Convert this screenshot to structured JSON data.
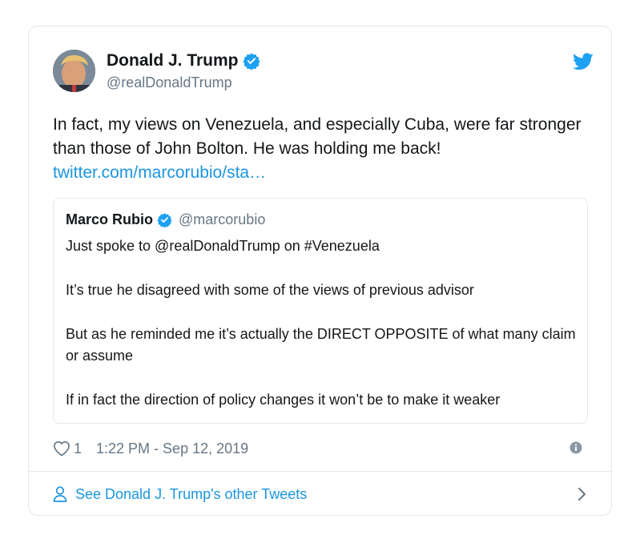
{
  "tweet": {
    "author_name": "Donald J. Trump",
    "author_handle": "@realDonaldTrump",
    "text": "In fact, my views on Venezuela, and especially Cuba, were far stronger than those of John Bolton. He was holding me back!",
    "link": "twitter.com/marcorubio/sta…",
    "likes": "1",
    "timestamp": "1:22 PM - Sep 12, 2019"
  },
  "quote": {
    "author_name": "Marco Rubio",
    "author_handle": "@marcorubio",
    "paragraphs": [
      "Just spoke to @realDonaldTrump on #Venezuela",
      "It’s true he disagreed with some of the views of previous advisor",
      "But as he reminded me it’s actually the DIRECT OPPOSITE of what many claim or assume",
      "If in fact the direction of policy changes it won’t be to make it weaker"
    ]
  },
  "footer": {
    "see_more": "See Donald J. Trump's other Tweets"
  },
  "colors": {
    "accent": "#1b95e0",
    "verified": "#1da1f2",
    "muted": "#657786",
    "border": "#e1e8ed"
  },
  "icons": [
    "verified-badge-icon",
    "twitter-bird-icon",
    "heart-icon",
    "info-icon",
    "person-icon",
    "chevron-right-icon"
  ]
}
